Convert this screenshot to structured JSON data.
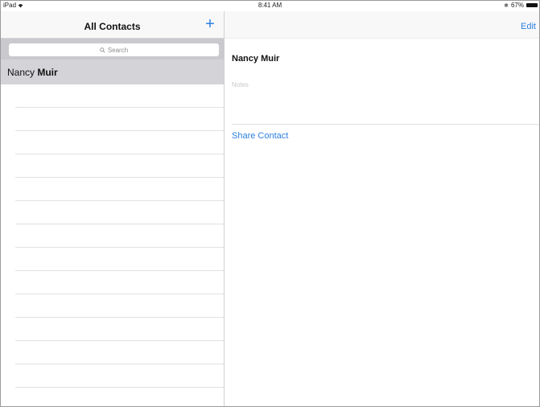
{
  "status_bar": {
    "device": "iPad",
    "time": "8:41 AM",
    "battery": "67%",
    "icons": [
      "wifi-icon",
      "bluetooth-icon",
      "battery-icon"
    ]
  },
  "left_pane": {
    "title": "All Contacts",
    "add_label": "+",
    "search_placeholder": "Search",
    "contacts": [
      {
        "first": "Nancy",
        "last": "Muir",
        "selected": true
      }
    ]
  },
  "right_pane": {
    "edit_label": "Edit",
    "contact_name": "Nancy Muir",
    "notes_placeholder": "Notes",
    "share_label": "Share Contact"
  },
  "colors": {
    "accent": "#2c7fe0",
    "selected_row": "#d4d4d8",
    "search_bar": "#c9c9ce"
  }
}
